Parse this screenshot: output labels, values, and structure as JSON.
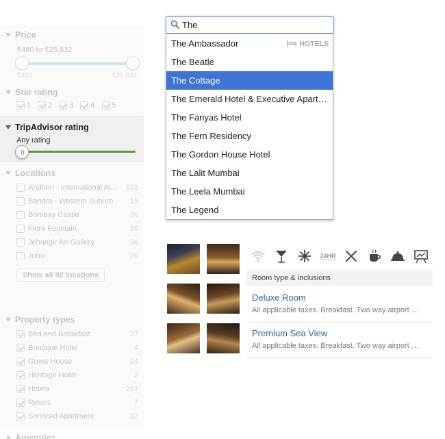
{
  "sidebar": {
    "price": {
      "title": "Price",
      "range_text": "₹480 to ₹25,832",
      "min_label": "₹480",
      "max_label": "₹25,832"
    },
    "star_rating": {
      "title": "Star rating",
      "options": [
        "1",
        "2",
        "3",
        "4",
        "5"
      ]
    },
    "tripadvisor": {
      "title": "TripAdvisor rating",
      "value_label": "Any rating"
    },
    "locations": {
      "title": "Locations",
      "items": [
        {
          "label": "Andheri - International Ai...",
          "count": "102"
        },
        {
          "label": "Bandra - Western Suburb",
          "count": "15"
        },
        {
          "label": "Bombay Castle",
          "count": "36"
        },
        {
          "label": "Flora Fountain",
          "count": "36"
        },
        {
          "label": "Jehangir Art Gallery",
          "count": "36"
        },
        {
          "label": "Juhu",
          "count": "20"
        }
      ],
      "show_all_label": "Show all 92 locations"
    },
    "property_types": {
      "title": "Property types",
      "items": [
        {
          "label": "Bed and Breakfast",
          "count": "37"
        },
        {
          "label": "Boutique Hotel",
          "count": "4"
        },
        {
          "label": "Guest House",
          "count": "24"
        },
        {
          "label": "Heritage Hotel",
          "count": "3"
        },
        {
          "label": "Hotels",
          "count": "261"
        },
        {
          "label": "Resort",
          "count": "7"
        },
        {
          "label": "Serviced Apartment",
          "count": "32"
        }
      ]
    },
    "amenities": {
      "title": "Amenities"
    }
  },
  "search": {
    "value": "The",
    "category_label": "HOTELS",
    "suggestions": [
      "The Ambassador",
      "The Beatle",
      "The Cottage",
      "The Emerald Hotel & Executive Apart…",
      "The Fariyas Hotel",
      "The Fern Residency",
      "The Gordon House Hotel",
      "The Lalit Mumbai",
      "The Leela Mumbai",
      "The Legend"
    ],
    "active_index": 2
  },
  "hotel": {
    "amenity_icons": [
      "wifi-icon",
      "bar-icon",
      "ac-icon",
      "24hr-frontdesk-icon",
      "restaurant-icon",
      "coffee-icon",
      "room-service-icon",
      "business-center-icon"
    ],
    "frontdesk_text": "24HR",
    "room_header": "Room type & inclusions",
    "rooms": [
      {
        "name": "Deluxe Room",
        "desc": "All applicable taxes. Breakfast. Two way airport …"
      },
      {
        "name": "Premium Sea View",
        "desc": "All applicable taxes. Breakfast. Two way airport …"
      }
    ]
  },
  "colors": {
    "accent": "#3d74d6",
    "link": "#2a66b5",
    "rating_track": "#5a9a3a"
  }
}
